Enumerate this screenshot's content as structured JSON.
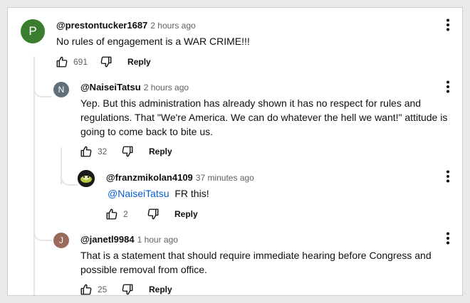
{
  "comments": [
    {
      "avatar_letter": "P",
      "avatar_color": "#3a7d2e",
      "author": "@prestontucker1687",
      "time": "2 hours ago",
      "text": "No rules of engagement is a WAR CRIME!!!",
      "likes": "691",
      "reply_label": "Reply"
    },
    {
      "avatar_letter": "N",
      "avatar_color": "#5f6f7c",
      "author": "@NaiseiTatsu",
      "time": "2 hours ago",
      "text": "Yep. But this administration has already shown it has no respect for rules and regulations. That \"We're America. We can do whatever the hell we want!\" attitude is going to come back to bite us.",
      "likes": "32",
      "reply_label": "Reply"
    },
    {
      "avatar_letter": "",
      "avatar_color": "#1a1a1a",
      "author": "@franzmikolan4109",
      "time": "37 minutes ago",
      "mention": "@NaiseiTatsu",
      "text": "FR this!",
      "likes": "2",
      "reply_label": "Reply"
    },
    {
      "avatar_letter": "J",
      "avatar_color": "#9a6a5c",
      "author": "@janetl9984",
      "time": "1 hour ago",
      "text": "That is a statement that should require immediate hearing before Congress and possible removal from office.",
      "likes": "25",
      "reply_label": "Reply"
    }
  ],
  "icons": {
    "like": "thumbs-up-icon",
    "dislike": "thumbs-down-icon",
    "menu": "more-vert-icon"
  }
}
